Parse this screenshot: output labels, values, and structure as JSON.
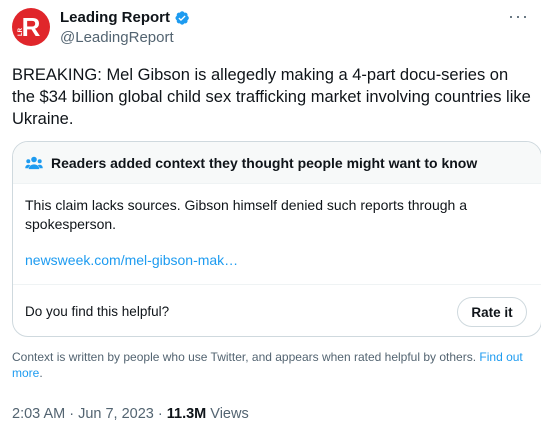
{
  "author": {
    "avatar_letter": "R",
    "avatar_sub": "LR",
    "display_name": "Leading Report",
    "handle": "@LeadingReport",
    "verified_color": "#1d9bf0",
    "avatar_color": "#e0262b"
  },
  "more_menu": "···",
  "tweet": {
    "text": "BREAKING: Mel Gibson is allegedly making a 4-part docu-series on the $34 billion global child sex trafficking market involving countries like Ukraine."
  },
  "community_note": {
    "title": "Readers added context they thought people might want to know",
    "body": "This claim lacks sources. Gibson himself denied such reports through a spokesperson.",
    "link": "newsweek.com/mel-gibson-mak…",
    "helpful_question": "Do you find this helpful?",
    "rate_button": "Rate it"
  },
  "context_note": {
    "text": "Context is written by people who use Twitter, and appears when rated helpful by others.",
    "find_out_more": "Find out more",
    "period": "."
  },
  "meta": {
    "time_date": "2:03 AM · Jun 7, 2023 · ",
    "views_count": "11.3M",
    "views_label": " Views"
  }
}
